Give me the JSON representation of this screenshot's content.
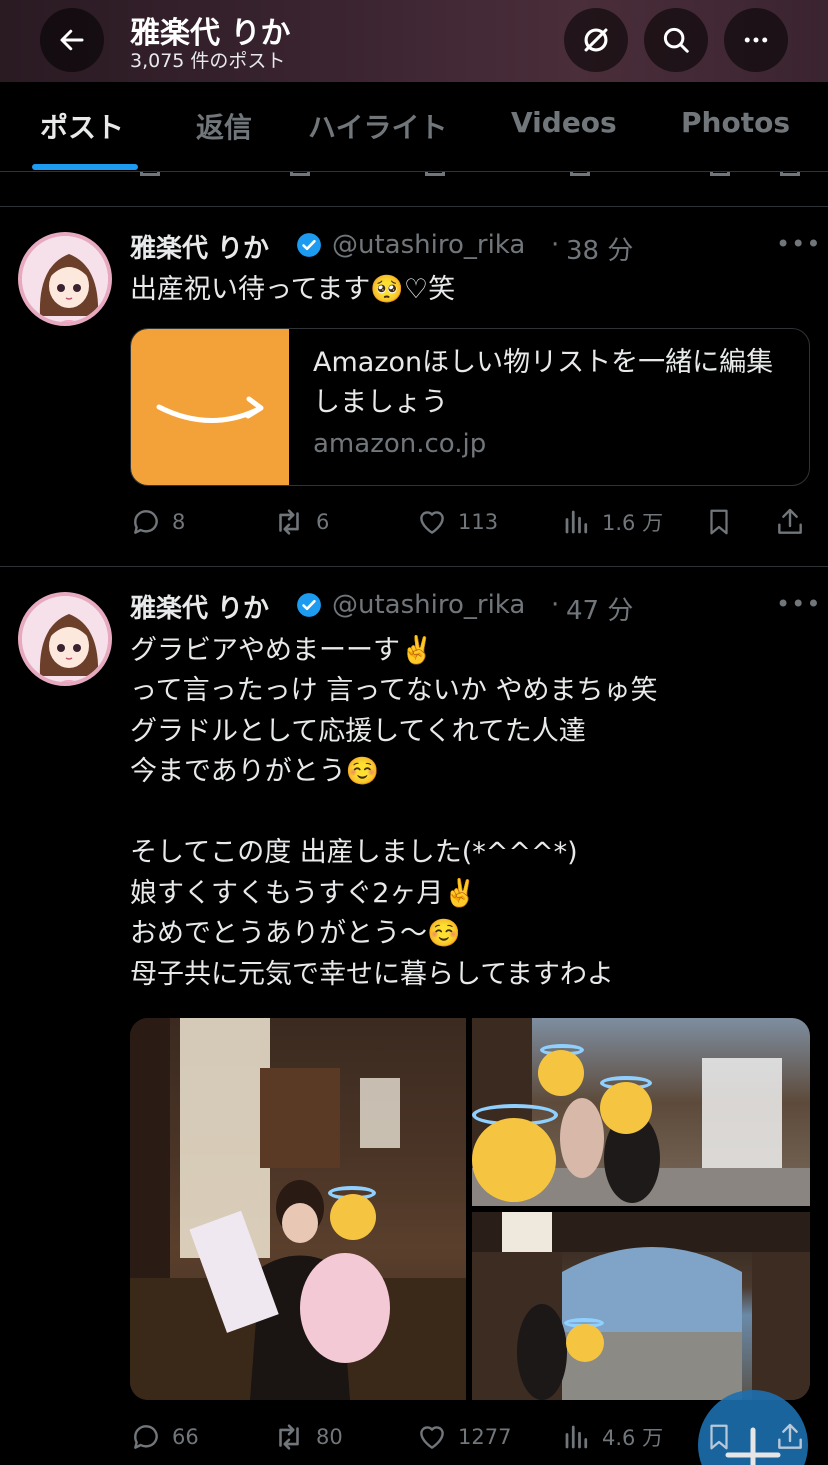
{
  "header": {
    "title": "雅楽代 りか",
    "subtitle": "3,075 件のポスト"
  },
  "tabs": [
    {
      "label": "ポスト",
      "active": true
    },
    {
      "label": "返信",
      "active": false
    },
    {
      "label": "ハイライト",
      "active": false
    },
    {
      "label": "Videos",
      "active": false
    },
    {
      "label": "Photos",
      "active": false
    }
  ],
  "tweets": [
    {
      "name": "雅楽代 りか",
      "handle": "@utashiro_rika",
      "time": "38 分",
      "lines": [
        "出産祝い待ってます🥺♡笑"
      ],
      "card": {
        "title": "Amazonほしい物リストを一緒に編集しましょう",
        "domain": "amazon.co.jp"
      },
      "replies": "8",
      "reposts": "6",
      "likes": "113",
      "views": "1.6 万"
    },
    {
      "name": "雅楽代 りか",
      "handle": "@utashiro_rika",
      "time": "47 分",
      "lines": [
        "グラビアやめまーーす✌️",
        "って言ったっけ 言ってないか やめまちゅ笑",
        "グラドルとして応援してくれてた人達",
        "今までありがとう☺️",
        "",
        "そしてこの度 出産しました(*^^^*)",
        "娘すくすくもうすぐ2ヶ月✌️",
        "おめでとうありがとう〜☺️",
        "母子共に元気で幸せに暮らしてますわよ"
      ],
      "replies": "66",
      "reposts": "80",
      "likes": "1277",
      "views": "4.6 万"
    }
  ],
  "colors": {
    "background": "#000000",
    "text": "#e7e9ea",
    "muted": "#71767b",
    "accent": "#1d9bf0",
    "amazon_orange": "#f3a23a"
  }
}
